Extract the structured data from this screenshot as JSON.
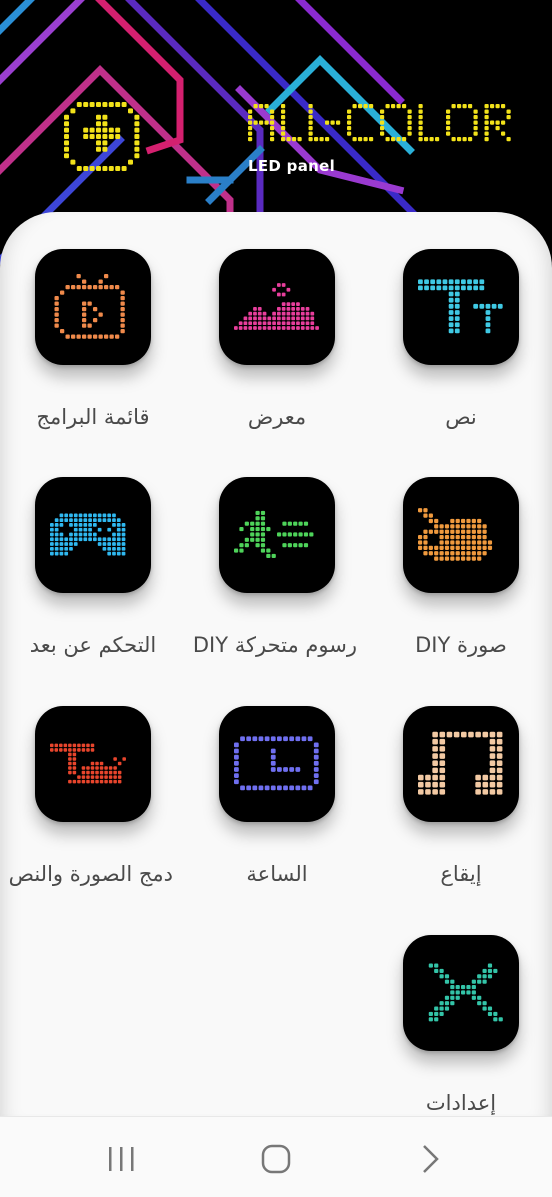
{
  "header": {
    "brand_title": "ALL-COLOR",
    "brand_subtitle": "LED panel",
    "brand_icon": "add-panel-icon"
  },
  "apps": [
    {
      "label": "قائمة البرامج",
      "icon": "tv-play-icon",
      "color": "#f08a4b"
    },
    {
      "label": "معرض",
      "icon": "mountain-image-icon",
      "color": "#e83e9c"
    },
    {
      "label": "نص",
      "icon": "text-icon",
      "color": "#3fc9e4"
    },
    {
      "label": "التحكم عن بعد",
      "icon": "gamepad-icon",
      "color": "#2fb8f0"
    },
    {
      "label": "رسوم متحركة DIY",
      "icon": "running-man-icon",
      "color": "#4ed35a"
    },
    {
      "label": "صورة DIY",
      "icon": "palette-icon",
      "color": "#f09a3e"
    },
    {
      "label": "دمج الصورة والنص",
      "icon": "text-image-merge-icon",
      "color": "#e8452c"
    },
    {
      "label": "الساعة",
      "icon": "clock-icon",
      "color": "#6f6ff0"
    },
    {
      "label": "إيقاع",
      "icon": "music-note-icon",
      "color": "#f2c9a3"
    },
    {
      "label": "إعدادات",
      "icon": "tools-icon",
      "color": "#33c4a8"
    }
  ],
  "navbar": {
    "recent_icon": "recent-apps-icon",
    "home_icon": "home-icon",
    "back_icon": "back-icon"
  }
}
